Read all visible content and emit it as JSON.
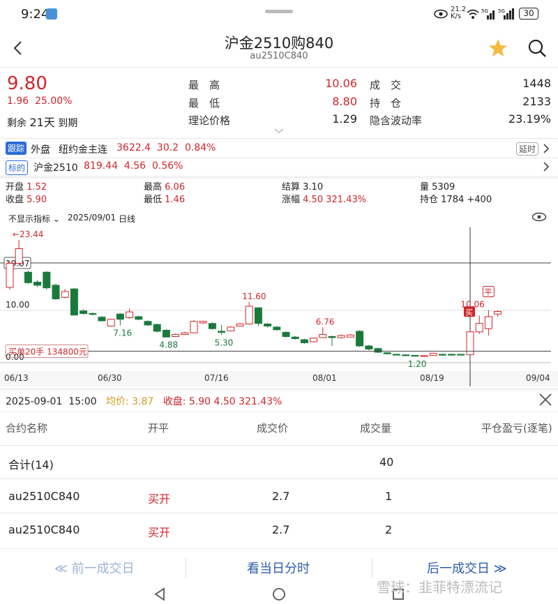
{
  "status": {
    "time": "9:24",
    "net_speed_top": "21.2",
    "net_speed_bottom": "K/s",
    "battery": "30"
  },
  "header": {
    "title": "沪金2510购840",
    "subtitle": "au2510C840"
  },
  "quote": {
    "price": "9.80",
    "change": "1.96",
    "change_pct": "25.00%",
    "remain_label": "剩余",
    "remain_days": "21天",
    "remain_suffix": "到期",
    "high_label": "最　高",
    "high": "10.06",
    "low_label": "最　低",
    "low": "8.80",
    "theo_label": "理论价格",
    "theo": "1.29",
    "volume_label": "成　交",
    "volume": "1448",
    "oi_label": "持　仓",
    "oi": "2133",
    "iv_label": "隐含波动率",
    "iv": "23.19%"
  },
  "track": {
    "tag": "跟踪",
    "market": "外盘",
    "name": "纽约金主连",
    "price": "3622.4",
    "chg": "30.2",
    "pct": "0.84%",
    "delay": "延时"
  },
  "underlying": {
    "tag": "标的",
    "name": "沪金2510",
    "price": "819.44",
    "chg": "4.56",
    "pct": "0.56%"
  },
  "ohlc": {
    "open_label": "开盘",
    "open": "1.52",
    "high_label": "最高",
    "high": "6.06",
    "settle_label": "结算",
    "settle": "3.10",
    "vol_label": "量",
    "vol": "5309",
    "close_label": "收盘",
    "close": "5.90",
    "low_label": "最低",
    "low": "1.46",
    "chgpct_label": "涨幅",
    "chg": "4.50",
    "pct": "321.43%",
    "oi_label": "持仓",
    "oi": "1784",
    "oi_chg": "+400"
  },
  "chart_toolbar": {
    "indicator": "不显示指标",
    "date": "2025/09/01",
    "period": "日线"
  },
  "chart_data": {
    "type": "candlestick",
    "ylabels": [
      "19.07",
      "10.00",
      "0.00"
    ],
    "xlabels": [
      "06/13",
      "06/30",
      "07/16",
      "08/01",
      "08/19",
      "09/04"
    ],
    "annotations": [
      "23.44",
      "11.60",
      "7.16",
      "4.88",
      "5.30",
      "6.76",
      "1.20",
      "10.06"
    ],
    "order_marker": "买单20手  134800元",
    "buy_tag": "买",
    "flat_tag": "平",
    "candles": [
      {
        "o": 14.4,
        "c": 19.0,
        "h": 19.5,
        "l": 14.0
      },
      {
        "o": 19.0,
        "c": 21.8,
        "h": 23.44,
        "l": 18.6
      },
      {
        "o": 17.3,
        "c": 15.3,
        "h": 17.6,
        "l": 15.0
      },
      {
        "o": 15.4,
        "c": 14.8,
        "h": 15.8,
        "l": 14.5
      },
      {
        "o": 17.3,
        "c": 14.3,
        "h": 17.5,
        "l": 14.0
      },
      {
        "o": 14.8,
        "c": 12.2,
        "h": 15.1,
        "l": 12.0
      },
      {
        "o": 12.5,
        "c": 13.6,
        "h": 14.1,
        "l": 12.3
      },
      {
        "o": 14.1,
        "c": 9.1,
        "h": 14.3,
        "l": 9.0
      },
      {
        "o": 9.9,
        "c": 9.4,
        "h": 10.2,
        "l": 9.2
      },
      {
        "o": 9.4,
        "c": 9.3,
        "h": 9.6,
        "l": 9.0
      },
      {
        "o": 8.7,
        "c": 8.0,
        "h": 8.9,
        "l": 7.9
      },
      {
        "o": 7.0,
        "c": 8.3,
        "h": 8.4,
        "l": 6.9
      },
      {
        "o": 9.3,
        "c": 8.3,
        "h": 9.5,
        "l": 7.16
      },
      {
        "o": 8.6,
        "c": 9.7,
        "h": 10.3,
        "l": 8.4
      },
      {
        "o": 8.8,
        "c": 8.3,
        "h": 9.0,
        "l": 8.1
      },
      {
        "o": 7.9,
        "c": 7.2,
        "h": 8.1,
        "l": 7.0
      },
      {
        "o": 7.3,
        "c": 6.0,
        "h": 7.5,
        "l": 5.8
      },
      {
        "o": 6.2,
        "c": 4.9,
        "h": 6.4,
        "l": 4.88
      },
      {
        "o": 5.0,
        "c": 5.4,
        "h": 5.6,
        "l": 4.9
      },
      {
        "o": 5.4,
        "c": 5.7,
        "h": 5.9,
        "l": 5.3
      },
      {
        "o": 5.7,
        "c": 7.9,
        "h": 8.1,
        "l": 5.6
      },
      {
        "o": 7.6,
        "c": 7.9,
        "h": 8.0,
        "l": 7.4
      },
      {
        "o": 7.5,
        "c": 6.5,
        "h": 7.7,
        "l": 6.3
      },
      {
        "o": 6.0,
        "c": 5.8,
        "h": 7.2,
        "l": 5.3
      },
      {
        "o": 6.1,
        "c": 6.8,
        "h": 7.0,
        "l": 6.0
      },
      {
        "o": 7.0,
        "c": 7.4,
        "h": 7.6,
        "l": 6.9
      },
      {
        "o": 7.4,
        "c": 10.8,
        "h": 11.6,
        "l": 7.3
      },
      {
        "o": 10.5,
        "c": 7.5,
        "h": 10.6,
        "l": 7.0
      },
      {
        "o": 7.4,
        "c": 7.0,
        "h": 7.6,
        "l": 6.7
      },
      {
        "o": 6.8,
        "c": 6.3,
        "h": 7.0,
        "l": 6.1
      },
      {
        "o": 5.8,
        "c": 5.0,
        "h": 6.0,
        "l": 4.8
      },
      {
        "o": 4.9,
        "c": 4.6,
        "h": 5.1,
        "l": 4.4
      },
      {
        "o": 4.4,
        "c": 3.8,
        "h": 4.6,
        "l": 3.6
      },
      {
        "o": 4.0,
        "c": 4.7,
        "h": 4.8,
        "l": 3.9
      },
      {
        "o": 4.8,
        "c": 5.4,
        "h": 6.76,
        "l": 4.7
      },
      {
        "o": 5.0,
        "c": 4.8,
        "h": 5.2,
        "l": 3.2
      },
      {
        "o": 4.8,
        "c": 5.2,
        "h": 5.4,
        "l": 4.6
      },
      {
        "o": 4.9,
        "c": 5.3,
        "h": 5.5,
        "l": 4.8
      },
      {
        "o": 6.0,
        "c": 3.2,
        "h": 6.2,
        "l": 3.0
      },
      {
        "o": 3.2,
        "c": 2.6,
        "h": 3.4,
        "l": 2.4
      },
      {
        "o": 2.7,
        "c": 2.0,
        "h": 2.9,
        "l": 1.9
      },
      {
        "o": 1.9,
        "c": 1.7,
        "h": 2.0,
        "l": 1.6
      },
      {
        "o": 1.6,
        "c": 1.5,
        "h": 1.7,
        "l": 1.4
      },
      {
        "o": 1.5,
        "c": 1.4,
        "h": 1.6,
        "l": 1.3
      },
      {
        "o": 1.4,
        "c": 1.3,
        "h": 1.5,
        "l": 1.2
      },
      {
        "o": 1.3,
        "c": 1.35,
        "h": 1.45,
        "l": 1.2
      },
      {
        "o": 1.4,
        "c": 1.8,
        "h": 1.9,
        "l": 1.3
      },
      {
        "o": 1.6,
        "c": 1.5,
        "h": 1.7,
        "l": 1.3
      },
      {
        "o": 1.6,
        "c": 1.5,
        "h": 1.7,
        "l": 1.4
      },
      {
        "o": 1.6,
        "c": 1.5,
        "h": 1.7,
        "l": 1.4
      },
      {
        "o": 1.52,
        "c": 5.9,
        "h": 6.06,
        "l": 1.46
      },
      {
        "o": 5.9,
        "c": 7.5,
        "h": 9.0,
        "l": 5.5
      },
      {
        "o": 6.5,
        "c": 8.8,
        "h": 10.06,
        "l": 5.2
      },
      {
        "o": 9.3,
        "c": 9.8,
        "h": 10.06,
        "l": 8.8
      }
    ]
  },
  "detail": {
    "date": "2025-09-01",
    "time": "15:00",
    "avg_label": "均价:",
    "avg": "3.87",
    "close_label": "收盘:",
    "close": "5.90",
    "chg": "4.50",
    "pct": "321.43%"
  },
  "table": {
    "headers": [
      "合约名称",
      "开平",
      "成交价",
      "成交量",
      "平仓盈亏(逐笔)"
    ],
    "total_label": "合计(14)",
    "total_vol": "40",
    "rows": [
      {
        "name": "au2510C840",
        "type": "买开",
        "price": "2.7",
        "vol": "1"
      },
      {
        "name": "au2510C840",
        "type": "买开",
        "price": "2.7",
        "vol": "2"
      }
    ]
  },
  "footer": {
    "prev": "前一成交日",
    "today": "看当日分时",
    "next": "后一成交日"
  },
  "watermark": "雪球：韭菲特漂流记"
}
